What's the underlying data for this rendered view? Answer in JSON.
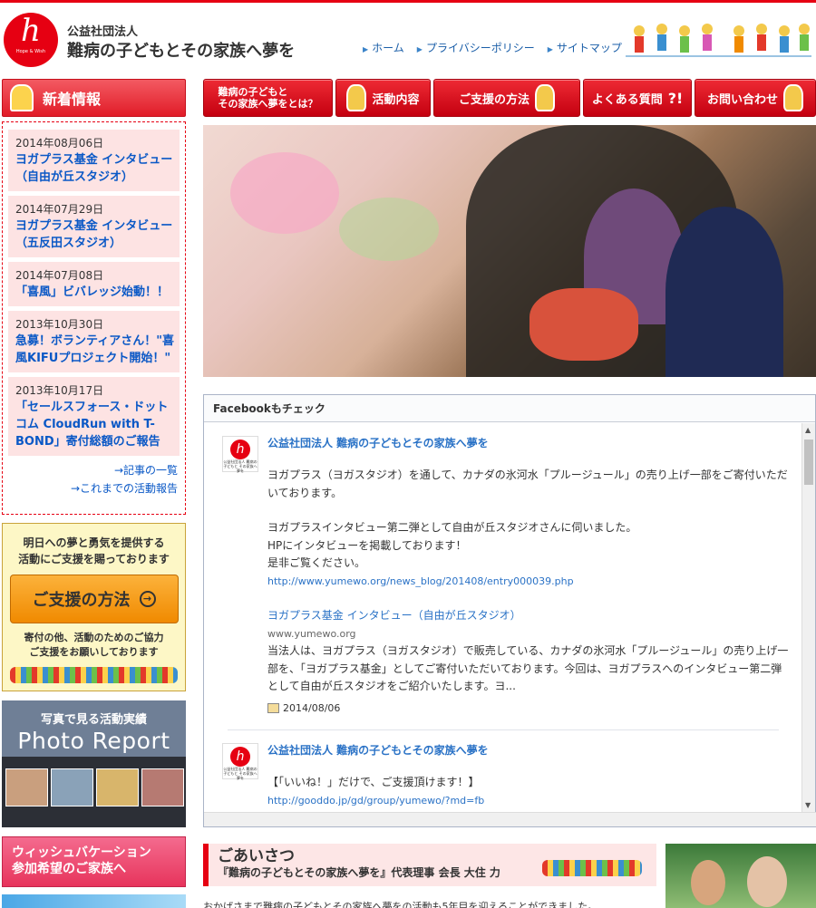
{
  "header": {
    "logo_text": "h",
    "logo_tag": "Hope & Wish",
    "org_type": "公益社団法人",
    "org_name": "難病の子どもとその家族へ夢を",
    "nav": [
      {
        "label": "ホーム"
      },
      {
        "label": "プライバシーポリシー"
      },
      {
        "label": "サイトマップ"
      }
    ]
  },
  "global_nav": [
    {
      "label": "難病の子どもと\nその家族へ夢をとは？"
    },
    {
      "label": "活動内容"
    },
    {
      "label": "ご支援の方法"
    },
    {
      "label": "よくある質問"
    },
    {
      "label": "お問い合わせ"
    }
  ],
  "news": {
    "heading": "新着情報",
    "items": [
      {
        "date": "2014年08月06日",
        "title": "ヨガプラス基金 インタビュー（自由が丘スタジオ）"
      },
      {
        "date": "2014年07月29日",
        "title": "ヨガプラス基金 インタビュー（五反田スタジオ）"
      },
      {
        "date": "2014年07月08日",
        "title": "「喜風」ビバレッジ始動！！"
      },
      {
        "date": "2013年10月30日",
        "title": "急募！ボランティアさん！\"喜風KIFUプロジェクト開始！\""
      },
      {
        "date": "2013年10月17日",
        "title": "「セールスフォース・ドットコム CloudRun with T-BOND」寄付総額のご報告"
      }
    ],
    "more_articles": "→記事の一覧",
    "more_reports": "→これまでの活動報告"
  },
  "support": {
    "lead": "明日への夢と勇気を提供する\n活動にご支援を賜っております",
    "button": "ご支援の方法",
    "note": "寄付の他、活動のためのご協力\nご支援をお願いしております"
  },
  "photo_report": {
    "sub": "写真で見る活動実績",
    "big": "Photo Report"
  },
  "wish": {
    "label": "ウィッシュバケーション\n参加希望のご家族へ"
  },
  "facebook": {
    "heading": "Facebookもチェック",
    "avatar_caption": "公益社団法人 難病の子どもと その家族へ夢を",
    "posts": [
      {
        "name": "公益社団法人 難病の子どもとその家族へ夢を",
        "p1": "ヨガプラス（ヨガスタジオ）を通して、カナダの氷河水「プルージュール」の売り上げ一部をご寄付いただいております。",
        "p2": "ヨガプラスインタビュー第二弾として自由が丘スタジオさんに伺いました。",
        "p3": "HPにインタビューを掲載しております！",
        "p4": "是非ご覧ください。",
        "link": "http://www.yumewo.org/news_blog/201408/entry000039.php",
        "link_title": "ヨガプラス基金 インタビュー（自由が丘スタジオ）",
        "link_domain": "www.yumewo.org",
        "link_desc": "当法人は、ヨガプラス（ヨガスタジオ）で販売している、カナダの氷河水「プルージュール」の売り上げ一部を、「ヨガプラス基金」としてご寄付いただいております。今回は、ヨガプラスへのインタビュー第二弾として自由が丘スタジオをご紹介いたします。ヨ...",
        "date": "2014/08/06"
      },
      {
        "name": "公益社団法人 難病の子どもとその家族へ夢を",
        "p1": "【「いいね！」だけで、ご支援頂けます！】",
        "link": "http://gooddo.jp/gd/group/yumewo/?md=fb"
      }
    ]
  },
  "greeting": {
    "heading": "ごあいさつ",
    "sub": "『難病の子どもとその家族へ夢を』代表理事 会長 大住 力",
    "text": "おかげさまで難病の子どもとその家族へ夢をの活動も5年目を迎えることができました。"
  }
}
